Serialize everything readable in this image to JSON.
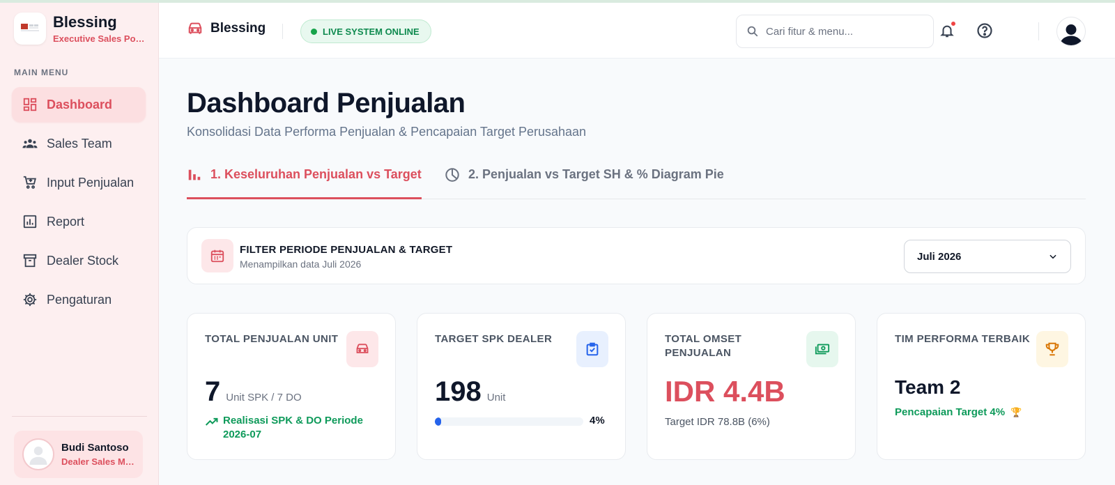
{
  "sidebar": {
    "brand_name": "Blessing",
    "brand_sub": "Executive Sales Portal",
    "menu_label": "MAIN MENU",
    "items": [
      {
        "label": "Dashboard",
        "icon": "dashboard-icon",
        "active": true
      },
      {
        "label": "Sales Team",
        "icon": "team-icon"
      },
      {
        "label": "Input Penjualan",
        "icon": "cart-icon"
      },
      {
        "label": "Report",
        "icon": "report-icon"
      },
      {
        "label": "Dealer Stock",
        "icon": "archive-icon"
      },
      {
        "label": "Pengaturan",
        "icon": "gear-icon"
      }
    ],
    "user": {
      "name": "Budi Santoso",
      "role": "Dealer Sales Manager"
    }
  },
  "header": {
    "brand_name": "Blessing",
    "status": "LIVE SYSTEM ONLINE",
    "search_placeholder": "Cari fitur & menu..."
  },
  "main": {
    "title": "Dashboard Penjualan",
    "subtitle": "Konsolidasi Data Performa Penjualan & Pencapaian Target Perusahaan",
    "tabs": [
      {
        "label": "1. Keseluruhan Penjualan vs Target",
        "active": true
      },
      {
        "label": "2. Penjualan vs Target SH & % Diagram Pie"
      }
    ],
    "filter": {
      "title": "FILTER PERIODE PENJUALAN & TARGET",
      "subtitle": "Menampilkan data Juli 2026",
      "selected": "Juli 2026"
    },
    "cards": {
      "sales": {
        "label": "TOTAL PENJUALAN UNIT",
        "value": "7",
        "unit": "Unit SPK / 7 DO",
        "trend": "Realisasi SPK & DO Periode 2026-07"
      },
      "target": {
        "label": "TARGET SPK DEALER",
        "value": "198",
        "unit": "Unit",
        "progress_pct": 4,
        "progress_label": "4%"
      },
      "omset": {
        "label": "TOTAL OMSET PENJUALAN",
        "value": "IDR 4.4B",
        "sub": "Target IDR 78.8B (6%)"
      },
      "team": {
        "label": "TIM PERFORMA TERBAIK",
        "value": "Team 2",
        "sub": "Pencapaian Target 4%",
        "trophy": "🏆"
      }
    }
  },
  "colors": {
    "accent": "#dc4f5d",
    "success": "#0e9a5a",
    "progress": "#2563eb"
  }
}
